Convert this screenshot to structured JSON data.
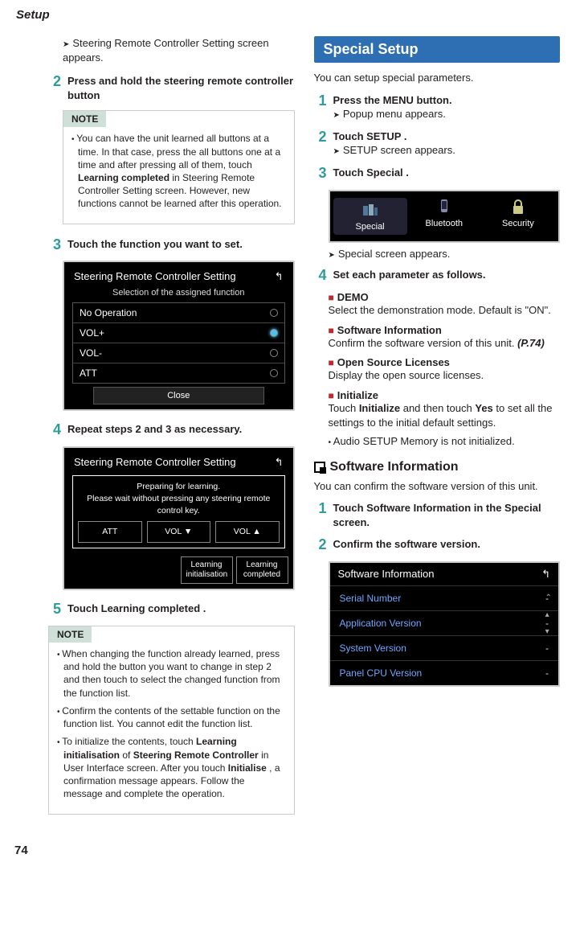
{
  "header": "Setup",
  "pagenum": "74",
  "left": {
    "pre_chevron": "Steering Remote Controller Setting screen appears.",
    "step2": {
      "num": "2",
      "text": "Press and hold the steering remote controller button"
    },
    "note1": {
      "label": "NOTE",
      "body": "You can have the unit learned all buttons at a time. In that case, press the all buttons one at a time and after pressing all of them, touch ",
      "bold1": "Learning completed",
      "body2": " in Steering Remote Controller Setting screen. However, new functions cannot be learned after this operation."
    },
    "step3": {
      "num": "3",
      "text": "Touch the function you want to set."
    },
    "ss1": {
      "title": "Steering Remote Controller Setting",
      "sub": "Selection of the assigned function",
      "rows": [
        "No Operation",
        "VOL+",
        "VOL-",
        "ATT"
      ],
      "close": "Close"
    },
    "step4": {
      "num": "4",
      "text": "Repeat steps 2 and 3 as necessary."
    },
    "ss2": {
      "title": "Steering Remote Controller Setting",
      "prep1": "Preparing for learning.",
      "prep2": "Please wait without pressing any steering remote control key.",
      "btns": [
        "ATT",
        "VOL ▼",
        "VOL ▲"
      ],
      "small1": "Learning initialisation",
      "small2": "Learning completed"
    },
    "step5": {
      "num": "5",
      "pre": "Touch ",
      "bold": "Learning completed",
      "post": " ."
    },
    "note2": {
      "label": "NOTE",
      "n1": "When changing the function already learned, press and hold the button you want to change in step 2 and then touch to select the changed function from the function list.",
      "n2": "Confirm the contents of the settable function on the function list. You cannot edit the function list.",
      "n3a": "To initialize the contents, touch ",
      "n3b": "Learning initialisation",
      "n3c": " of ",
      "n3d": "Steering Remote Controller",
      "n3e": " in User Interface screen. After you touch ",
      "n3f": "Initialise",
      "n3g": " , a confirmation message appears. Follow the message and complete the operation."
    }
  },
  "right": {
    "bar": "Special Setup",
    "intro": "You can setup special parameters.",
    "s1": {
      "num": "1",
      "a": "Press the ",
      "b": "MENU",
      "c": " button.",
      "chev": "Popup menu appears."
    },
    "s2": {
      "num": "2",
      "a": "Touch ",
      "b": "SETUP",
      "c": " .",
      "chev": "SETUP screen appears."
    },
    "s3": {
      "num": "3",
      "a": "Touch ",
      "b": "Special",
      "c": " ."
    },
    "tabs": [
      "Special",
      "Bluetooth",
      "Security"
    ],
    "s3chev": "Special screen appears.",
    "s4": {
      "num": "4",
      "text": "Set each parameter as follows."
    },
    "p1": {
      "title": "DEMO",
      "body": "Select the demonstration mode. Default is \"ON\"."
    },
    "p2": {
      "title": "Software Information",
      "body": "Confirm the software version of this unit.",
      "ref": "(P.74)"
    },
    "p3": {
      "title": "Open Source Licenses",
      "body": "Display the open source licenses."
    },
    "p4": {
      "title": "Initialize",
      "a": "Touch ",
      "b": "Initialize",
      "c": " and then touch ",
      "d": "Yes",
      "e": " to set all the settings to the initial default settings.",
      "bullet": "Audio SETUP Memory is not initialized."
    },
    "sub": "Software Information",
    "subintro": "You can confirm the software version of this unit.",
    "sw1": {
      "num": "1",
      "a": "Touch ",
      "b": "Software Information",
      "c": " in the Special screen."
    },
    "sw2": {
      "num": "2",
      "text": "Confirm the software version."
    },
    "swshot": {
      "title": "Software Information",
      "rows": [
        "Serial Number",
        "Application Version",
        "System Version",
        "Panel CPU Version"
      ],
      "val": "-"
    }
  }
}
